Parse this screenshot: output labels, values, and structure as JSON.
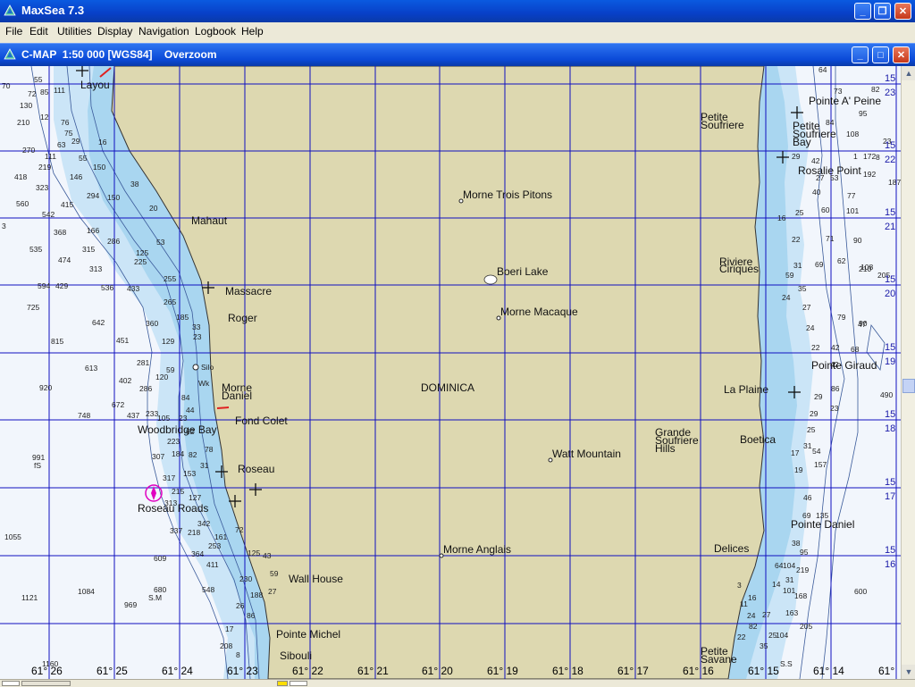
{
  "app": {
    "title": "MaxSea 7.3",
    "minimize_glyph": "_",
    "maximize_glyph": "❐",
    "close_glyph": "✕"
  },
  "menu": [
    "File",
    "Edit",
    "Utilities",
    "Display",
    "Navigation",
    "Logbook",
    "Help"
  ],
  "chart_window": {
    "title": "C-MAP  1:50 000 [WGS84]    Overzoom",
    "minimize_glyph": "_",
    "maximize_glyph": "□",
    "close_glyph": "✕"
  },
  "colors": {
    "land": "#ddd8b0",
    "deep_water": "#f2f6fc",
    "shallow_water": "#cbe5f7",
    "very_shallow": "#a9d6f0",
    "grid": "#1010c0",
    "contour": "#3a5a9a",
    "title_blue": "#0a46d0"
  },
  "longitude_labels": [
    "61° 26",
    "61° 25",
    "61° 24",
    "61° 23",
    "61° 22",
    "61° 21",
    "61° 20",
    "61° 19",
    "61° 18",
    "61° 17",
    "61° 16",
    "61° 15",
    "61° 14",
    "61°"
  ],
  "latitude_labels_right": [
    "15",
    "23",
    "15",
    "22",
    "15",
    "21",
    "15",
    "20",
    "15",
    "19",
    "15",
    "18",
    "15",
    "17",
    "15",
    "16"
  ],
  "place_names_west": [
    "Layou",
    "Mahaut",
    "Massacre",
    "Roger",
    "Morne",
    "Daniel",
    "Fond Colet",
    "Woodbridge Bay",
    "Roseau",
    "Roseau Roads",
    "Wall House",
    "Pointe Michel",
    "Sibouli",
    "Silo",
    "Wk"
  ],
  "place_names_inland": [
    "Morne Trois Pitons",
    "Boeri Lake",
    "Morne Macaque",
    "DOMINICA",
    "Watt Mountain",
    "Morne Anglais",
    "Grande",
    "Soufriere",
    "Hills"
  ],
  "place_names_east": [
    "Petite",
    "Soufriere",
    "Pointe A' Peine",
    "Petite",
    "Soufriere",
    "Bay",
    "Rosalie Point",
    "Riviere",
    "Ciriques",
    "Pointe Giraud",
    "La Plaine",
    "Boetica",
    "Pointe Daniel",
    "Delices",
    "Petite",
    "Savane"
  ],
  "depths_west": [
    "70",
    "55",
    "72",
    "85",
    "111",
    "130",
    "12",
    "76",
    "210",
    "75",
    "270",
    "29",
    "16",
    "63",
    "55",
    "150",
    "418",
    "111",
    "219",
    "146",
    "323",
    "294",
    "150",
    "560",
    "415",
    "542",
    "3",
    "38",
    "368",
    "166",
    "535",
    "474",
    "315",
    "286",
    "125",
    "225",
    "313",
    "594",
    "429",
    "536",
    "433",
    "255",
    "725",
    "265",
    "642",
    "360",
    "185",
    "815",
    "451",
    "129",
    "613",
    "281",
    "59",
    "920",
    "402",
    "120",
    "286",
    "672",
    "233",
    "105",
    "748",
    "437",
    "223",
    "991",
    "fS",
    "307",
    "184",
    "82",
    "153",
    "317",
    "215",
    "313",
    "337",
    "218",
    "161",
    "1055",
    "364",
    "253",
    "609",
    "411",
    "1084",
    "680",
    "548",
    "S.M",
    "1121",
    "969",
    "208",
    "1160",
    "17",
    "8",
    "53",
    "33",
    "23",
    "78",
    "31",
    "127",
    "342",
    "72",
    "125",
    "43",
    "59",
    "230",
    "188",
    "27",
    "86",
    "26",
    "84",
    "44",
    "62",
    "23",
    "20",
    "19"
  ],
  "depths_east": [
    "64",
    "73",
    "82",
    "95",
    "84",
    "108",
    "172",
    "1",
    "23",
    "8",
    "187",
    "29",
    "42",
    "27",
    "53",
    "77",
    "192",
    "40",
    "101",
    "25",
    "60",
    "71",
    "90",
    "22",
    "16",
    "31",
    "62",
    "210",
    "69",
    "59",
    "108",
    "205",
    "35",
    "27",
    "79",
    "24",
    "24",
    "47",
    "90",
    "22",
    "42",
    "68",
    "42",
    "490",
    "29",
    "86",
    "29",
    "23",
    "25",
    "17",
    "31",
    "54",
    "157",
    "19",
    "46",
    "69",
    "135",
    "38",
    "104",
    "219",
    "95",
    "64",
    "101",
    "600",
    "168",
    "24",
    "27",
    "163",
    "104",
    "3",
    "25",
    "S.S",
    "22",
    "35",
    "82",
    "205",
    "16",
    "11",
    "14",
    "31"
  ],
  "status": ""
}
